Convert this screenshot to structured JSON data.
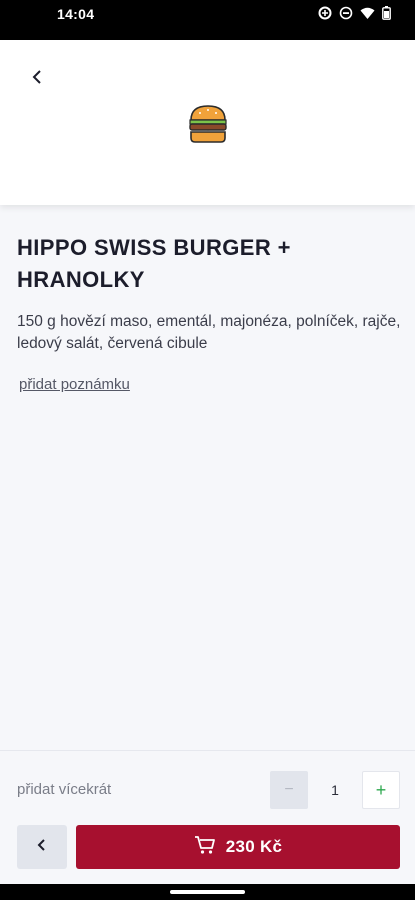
{
  "status_bar": {
    "time": "14:04",
    "icons": [
      "data-saver-icon",
      "do-not-disturb-icon",
      "wifi-icon",
      "battery-icon"
    ]
  },
  "header": {
    "back_icon": "chevron-left-icon",
    "product_icon": "burger-icon"
  },
  "product": {
    "title": "HIPPO SWISS BURGER + HRANOLKY",
    "description": "150 g hovězí maso, ementál, majonéza, polníček, rajče, ledový salát, červená cibule",
    "add_note_label": "přidat poznámku"
  },
  "footer": {
    "quantity_label": "přidat vícekrát",
    "quantity_value": "1",
    "minus_label": "−",
    "plus_label": "+",
    "price_label": "230 Kč"
  },
  "colors": {
    "accent": "#a7102f",
    "plus_green": "#2ea84f",
    "background": "#f6f7fa"
  }
}
